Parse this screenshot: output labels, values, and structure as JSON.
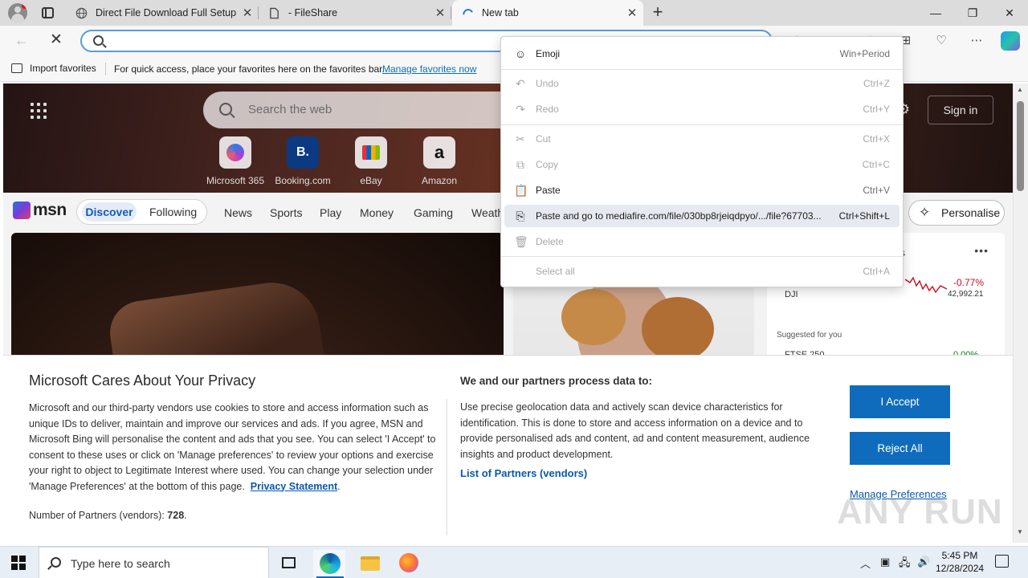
{
  "browser": {
    "tabs": [
      {
        "label": "Direct File Download Full Setup",
        "close": "✕"
      },
      {
        "label": "- FileShare",
        "close": "✕"
      },
      {
        "label": "New tab",
        "close": "✕"
      }
    ],
    "new_tab_symbol": "+",
    "window_controls": {
      "minimize": "—",
      "maximize": "❐",
      "close": "✕"
    },
    "address": {
      "value": "",
      "placeholder": ""
    },
    "favorites_bar": {
      "import_label": "Import favorites",
      "hint": "For quick access, place your favorites here on the favorites bar.",
      "manage_link": "Manage favorites now"
    }
  },
  "context_menu": {
    "items": [
      {
        "icon": "emoji-icon",
        "label": "Emoji",
        "shortcut": "Win+Period",
        "enabled": true
      },
      {
        "icon": "undo-icon",
        "label": "Undo",
        "shortcut": "Ctrl+Z",
        "enabled": false
      },
      {
        "icon": "redo-icon",
        "label": "Redo",
        "shortcut": "Ctrl+Y",
        "enabled": false
      },
      {
        "icon": "cut-icon",
        "label": "Cut",
        "shortcut": "Ctrl+X",
        "enabled": false
      },
      {
        "icon": "copy-icon",
        "label": "Copy",
        "shortcut": "Ctrl+C",
        "enabled": false
      },
      {
        "icon": "paste-icon",
        "label": "Paste",
        "shortcut": "Ctrl+V",
        "enabled": true
      },
      {
        "icon": "paste-go-icon",
        "label": "Paste and go to mediafire.com/file/030bp8rjeiqdpyo/.../file?67703...",
        "shortcut": "Ctrl+Shift+L",
        "enabled": true,
        "highlighted": true
      },
      {
        "icon": "delete-icon",
        "label": "Delete",
        "shortcut": "",
        "enabled": false
      },
      {
        "icon": "",
        "label": "Select all",
        "shortcut": "Ctrl+A",
        "enabled": false
      }
    ]
  },
  "msn": {
    "search_placeholder": "Search the web",
    "sign_in": "Sign in",
    "quick_links": [
      "Microsoft 365",
      "Booking.com",
      "eBay",
      "Amazon"
    ],
    "tile_glyphs": [
      "",
      "B.",
      "",
      "a"
    ],
    "logo_text": "msn",
    "feed_tabs": {
      "discover": "Discover",
      "following": "Following"
    },
    "nav": [
      "News",
      "Sports",
      "Play",
      "Money",
      "Gaming",
      "Weath"
    ],
    "personalise": "Personalise",
    "widget": {
      "title_fragment": "s",
      "stock_symbol": "DJI",
      "stock_change": "-0.77%",
      "stock_value": "42,992.21",
      "suggested": "Suggested for you",
      "suggested_symbol": "FTSE 250",
      "suggested_change": "0.00%"
    }
  },
  "privacy": {
    "title": "Microsoft Cares About Your Privacy",
    "body": "Microsoft and our third-party vendors use cookies to store and access information such as unique IDs to deliver, maintain and improve our services and ads. If you agree, MSN and Microsoft Bing will personalise the content and ads that you see. You can select 'I Accept' to consent to these uses or click on 'Manage preferences' to review your options and exercise your right to object to Legitimate Interest where used.  You can change your selection under 'Manage Preferences' at the bottom of this page.",
    "statement_link": "Privacy Statement",
    "partners_count_label": "Number of Partners (vendors): ",
    "partners_count": "728",
    "process_title": "We and our partners process data to:",
    "process_body": "Use precise geolocation data and actively scan device characteristics for identification. This is done to store and access information on a device and to provide personalised ads and content, ad and content measurement, audience insights and product development.",
    "partners_link": "List of Partners (vendors)",
    "accept": "I Accept",
    "reject": "Reject All",
    "manage": "Manage Preferences",
    "watermark": "ANY RUN"
  },
  "taskbar": {
    "search_placeholder": "Type here to search",
    "time": "5:45 PM",
    "date": "12/28/2024"
  },
  "colors": {
    "accent": "#0f6cbd",
    "tab_strip": "#dcdcdc",
    "negative": "#c50f1f",
    "positive": "#107c10"
  }
}
